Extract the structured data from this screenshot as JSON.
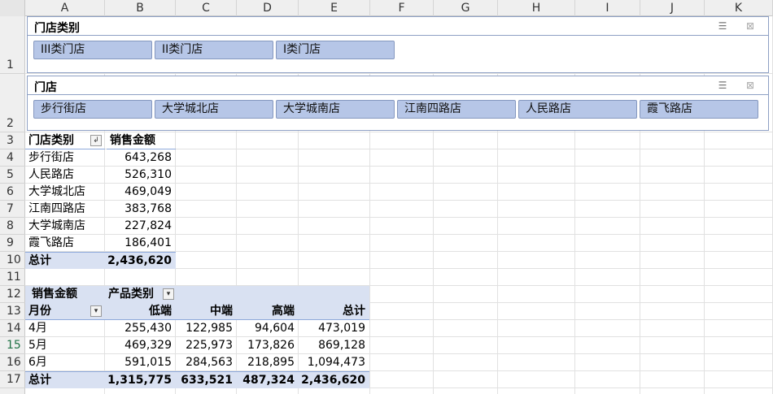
{
  "columns": [
    "A",
    "B",
    "C",
    "D",
    "E",
    "F",
    "G",
    "H",
    "I",
    "J",
    "K"
  ],
  "rows": [
    "1",
    "2",
    "3",
    "4",
    "5",
    "6",
    "7",
    "8",
    "9",
    "10",
    "11",
    "12",
    "13",
    "14",
    "15",
    "16",
    "17"
  ],
  "selected_row": "15",
  "slicer_store_type": {
    "title": "门店类别",
    "items": [
      "III类门店",
      "II类门店",
      "I类门店"
    ]
  },
  "slicer_store": {
    "title": "门店",
    "items": [
      "步行街店",
      "大学城北店",
      "大学城南店",
      "江南四路店",
      "人民路店",
      "霞飞路店"
    ]
  },
  "slicer_icons": {
    "multi_select": "multi-select-icon",
    "clear_filter": "clear-filter-icon"
  },
  "pivot1": {
    "header_row": "门店类别",
    "header_value": "销售金额",
    "rows": [
      {
        "label": "步行街店",
        "value": "643,268"
      },
      {
        "label": "人民路店",
        "value": "526,310"
      },
      {
        "label": "大学城北店",
        "value": "469,049"
      },
      {
        "label": "江南四路店",
        "value": "383,768"
      },
      {
        "label": "大学城南店",
        "value": "227,824"
      },
      {
        "label": "霞飞路店",
        "value": "186,401"
      }
    ],
    "total_label": "总计",
    "total_value": "2,436,620"
  },
  "pivot2": {
    "value_field": "销售金额",
    "column_field": "产品类别",
    "row_field": "月份",
    "col_headers": [
      "低端",
      "中端",
      "高端",
      "总计"
    ],
    "rows": [
      {
        "label": "4月",
        "values": [
          "255,430",
          "122,985",
          "94,604",
          "473,019"
        ]
      },
      {
        "label": "5月",
        "values": [
          "469,329",
          "225,973",
          "173,826",
          "869,128"
        ]
      },
      {
        "label": "6月",
        "values": [
          "591,015",
          "284,563",
          "218,895",
          "1,094,473"
        ]
      }
    ],
    "total_label": "总计",
    "total_values": [
      "1,315,775",
      "633,521",
      "487,324",
      "2,436,620"
    ]
  },
  "colors": {
    "slicer_button": "#b6c6e7",
    "pivot_band": "#d9e1f2",
    "selected_row_header": "#217346"
  }
}
